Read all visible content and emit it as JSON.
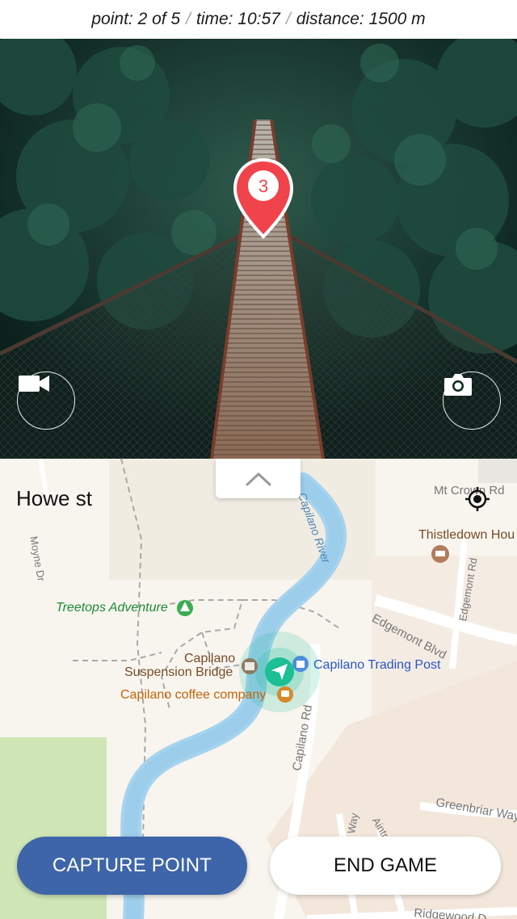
{
  "status_bar": {
    "point_label": "point: 2 of 5",
    "time_label": "time: 10:57",
    "distance_label": "distance: 1500 m",
    "separator": "/"
  },
  "photo": {
    "marker_number": "3",
    "marker_color": "#f0434b",
    "video_icon": "video-camera-icon",
    "camera_icon": "camera-icon"
  },
  "map": {
    "street_title": "Howe st",
    "collapse_icon": "chevron-up-icon",
    "locate_icon": "crosshair-icon",
    "accent_color": "#1dbf95",
    "labels": {
      "mt_crown": "Mt Crown Rd",
      "thistledown": "Thistledown Hou",
      "treetops": "Treetops Adventure",
      "bridge_line1": "Capilano",
      "bridge_line2": "Suspension Bridge",
      "coffee": "Capilano coffee company",
      "trading_post": "Capilano Trading Post",
      "edgemont_blvd": "Edgemont Blvd",
      "edgemont_rd": "Edgemont Rd",
      "capilano_rd": "Capilano Rd",
      "capilano_river": "Capilano River",
      "moyne_dr": "Moyne Dr",
      "greenbriar": "Greenbriar Way",
      "ridgewood": "Ridgewood D",
      "way": "Way",
      "aintree": "Aintre"
    }
  },
  "buttons": {
    "capture_label": "CAPTURE POINT",
    "end_label": "END GAME",
    "capture_color": "#3e65a9"
  }
}
